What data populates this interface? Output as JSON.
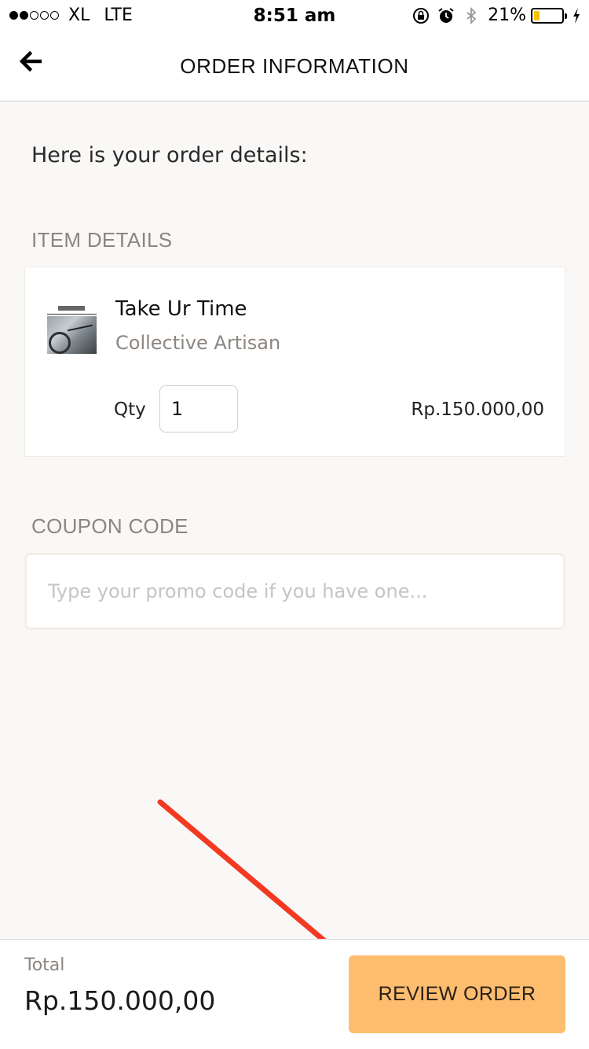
{
  "status_bar": {
    "carrier": "XL",
    "network": "LTE",
    "time": "8:51 am",
    "battery_percent": "21%",
    "battery_level": 0.21,
    "signal_bars_filled": 2,
    "signal_bars_total": 5,
    "icons": [
      "orientation-lock-icon",
      "alarm-icon",
      "bluetooth-icon",
      "battery-icon",
      "charging-bolt-icon"
    ]
  },
  "nav": {
    "back_icon": "back-arrow-icon",
    "title": "ORDER INFORMATION"
  },
  "content": {
    "intro": "Here is your order details:",
    "item_details_label": "ITEM DETAILS",
    "item": {
      "title": "Take Ur Time",
      "artist": "Collective Artisan",
      "qty_label": "Qty",
      "qty_value": "1",
      "price": "Rp.150.000,00"
    },
    "coupon_label": "COUPON CODE",
    "coupon_placeholder": "Type your promo code if you have one..."
  },
  "footer": {
    "total_label": "Total",
    "total_value": "Rp.150.000,00",
    "review_button": "REVIEW ORDER"
  },
  "colors": {
    "accent_button": "#fdbd6f",
    "annotation_arrow": "#f23a22",
    "page_background": "#f9f8f6",
    "muted_text": "#8c8680"
  }
}
